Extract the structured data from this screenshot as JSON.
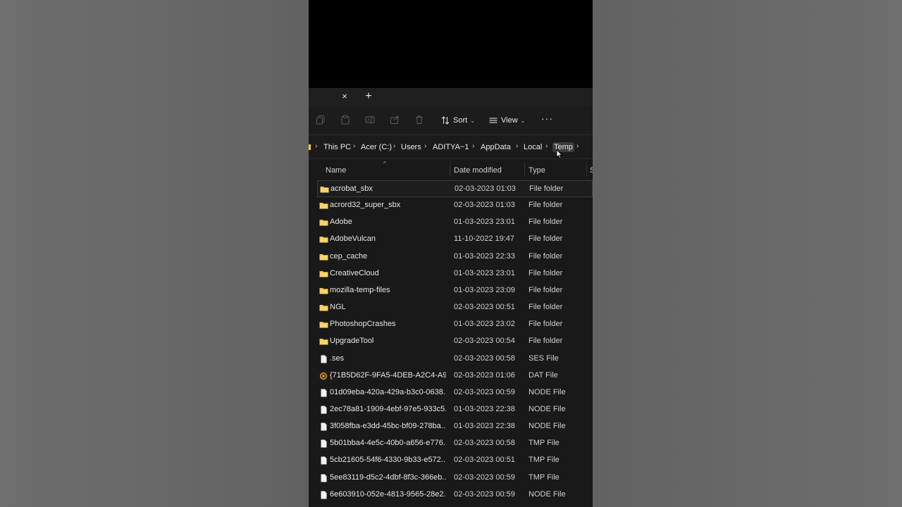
{
  "tabbar": {
    "close_glyph": "×",
    "new_glyph": "+"
  },
  "toolbar": {
    "sort_label": "Sort",
    "view_label": "View",
    "more_glyph": "···",
    "icons": [
      "copy-icon",
      "paste-icon",
      "rename-icon",
      "share-icon",
      "delete-icon",
      "sort-icon",
      "view-icon"
    ]
  },
  "address": {
    "crumbs": [
      "This PC",
      "Acer (C:)",
      "Users",
      "ADITYA~1",
      "AppData",
      "Local",
      "Temp"
    ],
    "separator": "›"
  },
  "columns": {
    "name": "Name",
    "date": "Date modified",
    "type": "Type",
    "size": "S"
  },
  "files": [
    {
      "name": "acrobat_sbx",
      "date": "02-03-2023 01:03",
      "type": "File folder",
      "icon": "folder-icon"
    },
    {
      "name": "acrord32_super_sbx",
      "date": "02-03-2023 01:03",
      "type": "File folder",
      "icon": "folder-icon"
    },
    {
      "name": "Adobe",
      "date": "01-03-2023 23:01",
      "type": "File folder",
      "icon": "folder-icon"
    },
    {
      "name": "AdobeVulcan",
      "date": "11-10-2022 19:47",
      "type": "File folder",
      "icon": "folder-icon"
    },
    {
      "name": "cep_cache",
      "date": "01-03-2023 22:33",
      "type": "File folder",
      "icon": "folder-icon"
    },
    {
      "name": "CreativeCloud",
      "date": "01-03-2023 23:01",
      "type": "File folder",
      "icon": "folder-icon"
    },
    {
      "name": "mozilla-temp-files",
      "date": "01-03-2023 23:09",
      "type": "File folder",
      "icon": "folder-icon"
    },
    {
      "name": "NGL",
      "date": "02-03-2023 00:51",
      "type": "File folder",
      "icon": "folder-icon"
    },
    {
      "name": "PhotoshopCrashes",
      "date": "01-03-2023 23:02",
      "type": "File folder",
      "icon": "folder-icon"
    },
    {
      "name": "UpgradeTool",
      "date": "02-03-2023 00:54",
      "type": "File folder",
      "icon": "folder-icon"
    },
    {
      "name": ".ses",
      "date": "02-03-2023 00:58",
      "type": "SES File",
      "icon": "file-icon"
    },
    {
      "name": "{71B5D62F-9FA5-4DEB-A2C4-A9...",
      "date": "02-03-2023 01:06",
      "type": "DAT File",
      "icon": "dat-file-icon"
    },
    {
      "name": "01d09eba-420a-429a-b3c0-0638...",
      "date": "02-03-2023 00:59",
      "type": "NODE File",
      "icon": "file-icon"
    },
    {
      "name": "2ec78a81-1909-4ebf-97e5-933c5...",
      "date": "01-03-2023 22:38",
      "type": "NODE File",
      "icon": "file-icon"
    },
    {
      "name": "3f058fba-e3dd-45bc-bf09-278ba...",
      "date": "01-03-2023 22:38",
      "type": "NODE File",
      "icon": "file-icon"
    },
    {
      "name": "5b01bba4-4e5c-40b0-a656-e776...",
      "date": "02-03-2023 00:58",
      "type": "TMP File",
      "icon": "file-icon"
    },
    {
      "name": "5cb21605-54f6-4330-9b33-e572...",
      "date": "02-03-2023 00:51",
      "type": "TMP File",
      "icon": "file-icon"
    },
    {
      "name": "5ee83119-d5c2-4dbf-8f3c-366eb...",
      "date": "02-03-2023 00:59",
      "type": "TMP File",
      "icon": "file-icon"
    },
    {
      "name": "6e603910-052e-4813-9565-28e2...",
      "date": "02-03-2023 00:59",
      "type": "NODE File",
      "icon": "file-icon"
    }
  ],
  "colors": {
    "folder": "#f4c443",
    "background": "#191919",
    "text": "#e6e6e6"
  }
}
